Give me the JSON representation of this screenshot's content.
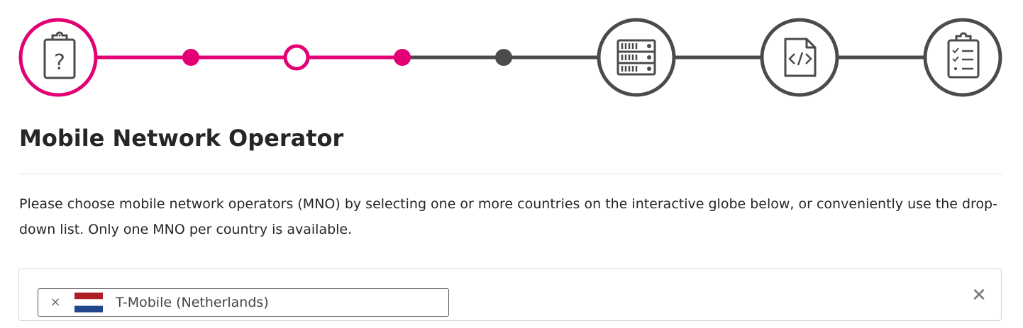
{
  "colors": {
    "active": "#e20074",
    "inactive": "#4b4b4b",
    "text": "#262626"
  },
  "stepper": {
    "steps": [
      {
        "kind": "icon",
        "icon": "clipboard-question-icon",
        "status": "active"
      },
      {
        "kind": "dot",
        "status": "completed"
      },
      {
        "kind": "dot",
        "status": "current"
      },
      {
        "kind": "dot",
        "status": "completed"
      },
      {
        "kind": "dot",
        "status": "pending"
      },
      {
        "kind": "icon",
        "icon": "server-rack-icon",
        "status": "pending"
      },
      {
        "kind": "icon",
        "icon": "code-file-icon",
        "status": "pending"
      },
      {
        "kind": "icon",
        "icon": "checklist-icon",
        "status": "pending"
      }
    ]
  },
  "page": {
    "title": "Mobile Network Operator",
    "description": "Please choose mobile network operators (MNO) by selecting one or more countries on the interactive globe below, or conveniently use the drop-down list. Only one MNO per country is available."
  },
  "mno_select": {
    "selected": [
      {
        "remove_symbol": "×",
        "flag_icon": "netherlands-flag-icon",
        "label": "T-Mobile (Netherlands)"
      }
    ],
    "clear_symbol": "✕"
  }
}
